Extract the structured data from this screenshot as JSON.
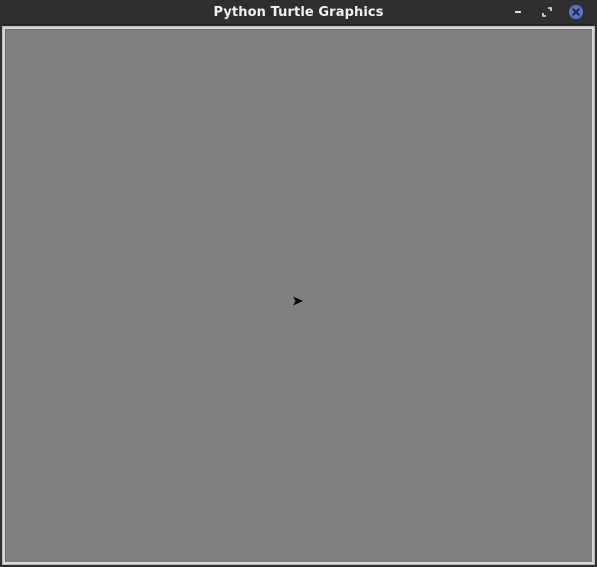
{
  "window": {
    "title": "Python Turtle Graphics",
    "controls": {
      "minimize_icon": "minimize-icon",
      "restore_icon": "restore-icon",
      "close_icon": "close-icon"
    },
    "colors": {
      "titlebar_bg": "#2f2f2f",
      "title_text": "#f2f2f2",
      "close_accent": "#5a73c8"
    }
  },
  "canvas": {
    "background": "#808080",
    "turtle": {
      "icon": "turtle-arrow-icon",
      "heading_degrees": 0,
      "color": "#000000"
    }
  }
}
